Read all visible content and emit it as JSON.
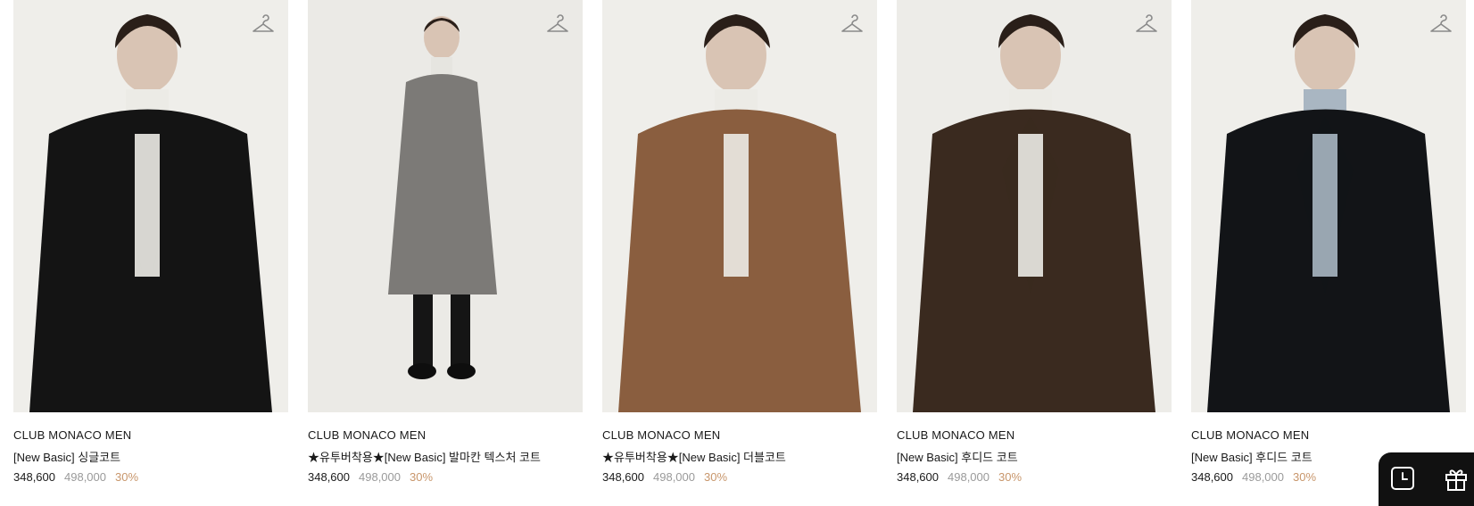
{
  "products": [
    {
      "brand": "CLUB MONACO MEN",
      "name": "[New Basic] 싱글코트",
      "price": "348,600",
      "original_price": "498,000",
      "discount": "30%",
      "coat_color": "#141414",
      "inner_color": "#ecebe6",
      "bg_color": "#efeeea"
    },
    {
      "brand": "CLUB MONACO MEN",
      "name": "★유투버착용★[New Basic] 발마칸 텍스처 코트",
      "price": "348,600",
      "original_price": "498,000",
      "discount": "30%",
      "coat_color": "#7c7a77",
      "inner_color": "#e6e5e0",
      "bg_color": "#ebeae6"
    },
    {
      "brand": "CLUB MONACO MEN",
      "name": "★유투버착용★[New Basic] 더블코트",
      "price": "348,600",
      "original_price": "498,000",
      "discount": "30%",
      "coat_color": "#8a5e3f",
      "inner_color": "#ecebe6",
      "bg_color": "#efeeea"
    },
    {
      "brand": "CLUB MONACO MEN",
      "name": "[New Basic] 후디드 코트",
      "price": "348,600",
      "original_price": "498,000",
      "discount": "30%",
      "coat_color": "#3a2a1f",
      "inner_color": "#ecebe6",
      "bg_color": "#edece8"
    },
    {
      "brand": "CLUB MONACO MEN",
      "name": "[New Basic] 후디드 코트",
      "price": "348,600",
      "original_price": "498,000",
      "discount": "30%",
      "coat_color": "#121417",
      "inner_color": "#a9b6c2",
      "bg_color": "#efeeea"
    }
  ],
  "icons": {
    "wishlist": "hanger-icon",
    "recent": "clock-icon",
    "gift": "gift-icon"
  },
  "colors": {
    "discount": "#c8966b",
    "original_price": "#9a9a9a",
    "floating_bg": "#111111"
  }
}
